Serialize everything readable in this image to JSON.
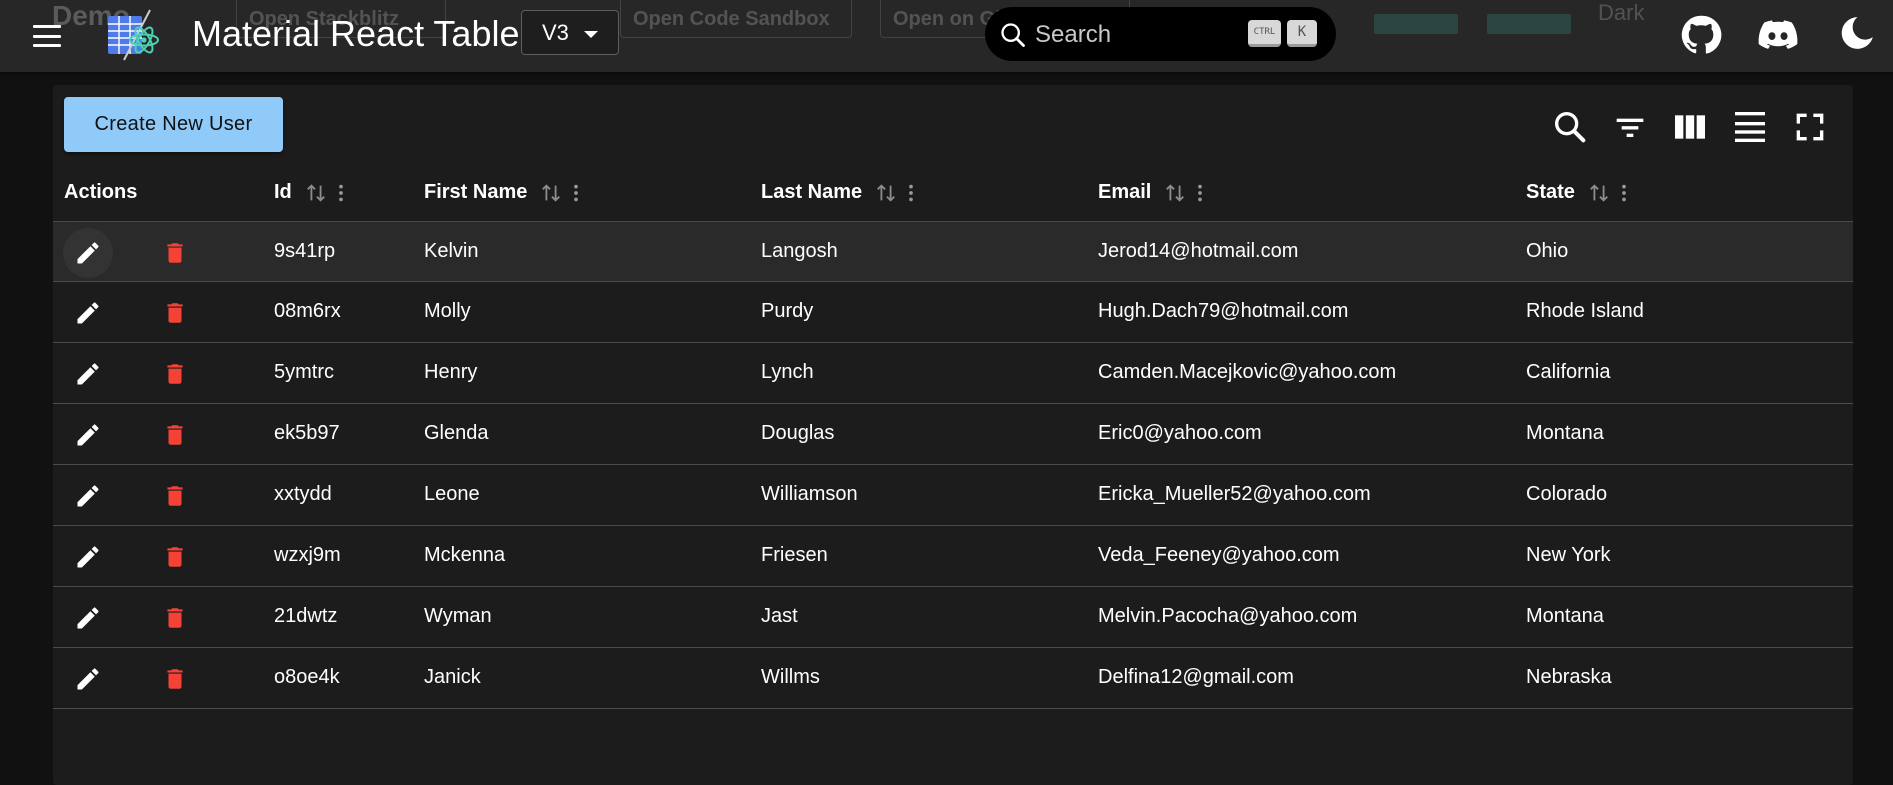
{
  "app": {
    "title": "Material React Table",
    "version": "V3",
    "search_placeholder": "Search",
    "shortcut_ctrl": "CTRL",
    "shortcut_key": "K"
  },
  "background_page": {
    "title": "Demo",
    "button_1": "Open Stackblitz",
    "button_2": "Open Code Sandbox",
    "button_3": "Open on GitHub",
    "theme_select": "Dark"
  },
  "toolbar": {
    "create_label": "Create New User"
  },
  "table": {
    "columns": {
      "actions": "Actions",
      "id": "Id",
      "first_name": "First Name",
      "last_name": "Last Name",
      "email": "Email",
      "state": "State"
    },
    "rows": [
      {
        "id": "9s41rp",
        "first_name": "Kelvin",
        "last_name": "Langosh",
        "email": "Jerod14@hotmail.com",
        "state": "Ohio"
      },
      {
        "id": "08m6rx",
        "first_name": "Molly",
        "last_name": "Purdy",
        "email": "Hugh.Dach79@hotmail.com",
        "state": "Rhode Island"
      },
      {
        "id": "5ymtrc",
        "first_name": "Henry",
        "last_name": "Lynch",
        "email": "Camden.Macejkovic@yahoo.com",
        "state": "California"
      },
      {
        "id": "ek5b97",
        "first_name": "Glenda",
        "last_name": "Douglas",
        "email": "Eric0@yahoo.com",
        "state": "Montana"
      },
      {
        "id": "xxtydd",
        "first_name": "Leone",
        "last_name": "Williamson",
        "email": "Ericka_Mueller52@yahoo.com",
        "state": "Colorado"
      },
      {
        "id": "wzxj9m",
        "first_name": "Mckenna",
        "last_name": "Friesen",
        "email": "Veda_Feeney@yahoo.com",
        "state": "New York"
      },
      {
        "id": "21dwtz",
        "first_name": "Wyman",
        "last_name": "Jast",
        "email": "Melvin.Pacocha@yahoo.com",
        "state": "Montana"
      },
      {
        "id": "o8oe4k",
        "first_name": "Janick",
        "last_name": "Willms",
        "email": "Delfina12@gmail.com",
        "state": "Nebraska"
      }
    ]
  },
  "colors": {
    "accent": "#90caf9",
    "delete": "#f44336",
    "surface": "#1c1c1c",
    "appbar": "#272727"
  },
  "icons": {
    "menu": "hamburger-menu-icon",
    "github": "github-icon",
    "discord": "discord-icon",
    "theme": "dark-mode-moon-icon",
    "search": "search-icon",
    "filter": "filter-list-icon",
    "columns": "view-column-icon",
    "density": "density-icon",
    "fullscreen": "fullscreen-icon",
    "edit": "edit-pencil-icon",
    "delete": "delete-trash-icon",
    "sort": "sort-arrows-icon",
    "column_menu": "more-vert-icon"
  }
}
